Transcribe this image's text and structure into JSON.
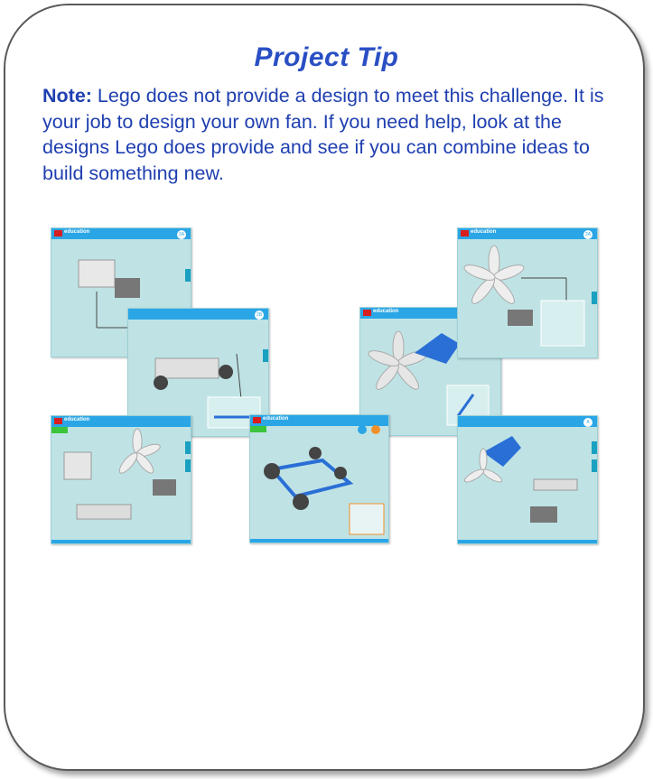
{
  "title": "Project Tip",
  "note": {
    "label": "Note:",
    "text": " Lego does not provide a design to meet this challenge. It is your job to design your own fan. If you need help, look at the designs Lego does provide and see if you can combine ideas to build something new."
  },
  "thumbnails": {
    "brand": "education",
    "items": [
      {
        "badge": "2A"
      },
      {
        "badge": "2B"
      },
      {
        "badge": ""
      },
      {
        "badge": "2A"
      },
      {
        "badge": ""
      },
      {
        "badge": ""
      },
      {
        "badge": "A"
      }
    ]
  },
  "colors": {
    "title": "#2a4fc4",
    "text": "#1f3fb0",
    "lego_blue": "#2aa6e6",
    "panel": "#bfe3e5"
  }
}
